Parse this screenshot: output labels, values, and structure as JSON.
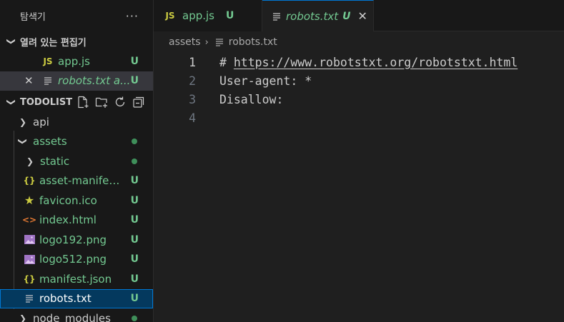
{
  "sidebar": {
    "title": "탐색기",
    "more": "···",
    "open_editors": {
      "title": "열려 있는 편집기",
      "items": [
        {
          "icon": "JS",
          "label": "app.js",
          "badge": "U"
        },
        {
          "label": "robots.txt  a...",
          "badge": "U",
          "close": "✕"
        }
      ]
    },
    "project": {
      "title": "TODOLIST",
      "items": [
        {
          "label": "api"
        },
        {
          "label": "assets"
        },
        {
          "label": "static"
        },
        {
          "icon": "{}",
          "label": "asset-manifest....",
          "badge": "U"
        },
        {
          "icon": "★",
          "label": "favicon.ico",
          "badge": "U"
        },
        {
          "icon": "<>",
          "label": "index.html",
          "badge": "U"
        },
        {
          "label": "logo192.png",
          "badge": "U"
        },
        {
          "label": "logo512.png",
          "badge": "U"
        },
        {
          "icon": "{}",
          "label": "manifest.json",
          "badge": "U"
        },
        {
          "label": "robots.txt",
          "badge": "U"
        },
        {
          "label": "node_modules"
        }
      ]
    }
  },
  "tabs": [
    {
      "icon": "JS",
      "label": "app.js",
      "badge": "U"
    },
    {
      "label": "robots.txt",
      "badge": "U",
      "close": "✕"
    }
  ],
  "breadcrumb": {
    "folder": "assets",
    "sep": "›",
    "file": "robots.txt"
  },
  "editor": {
    "lines": [
      {
        "num": "1",
        "prefix": "# ",
        "url": "https://www.robotstxt.org/robotstxt.html"
      },
      {
        "num": "2",
        "text": "User-agent: *"
      },
      {
        "num": "3",
        "text": "Disallow:"
      },
      {
        "num": "4",
        "text": ""
      }
    ]
  },
  "colors": {
    "modified_green": "#73c991",
    "accent_blue": "#0078d4",
    "js_yellow": "#cbcb41",
    "html_orange": "#e37933",
    "image_purple": "#a074c4"
  }
}
